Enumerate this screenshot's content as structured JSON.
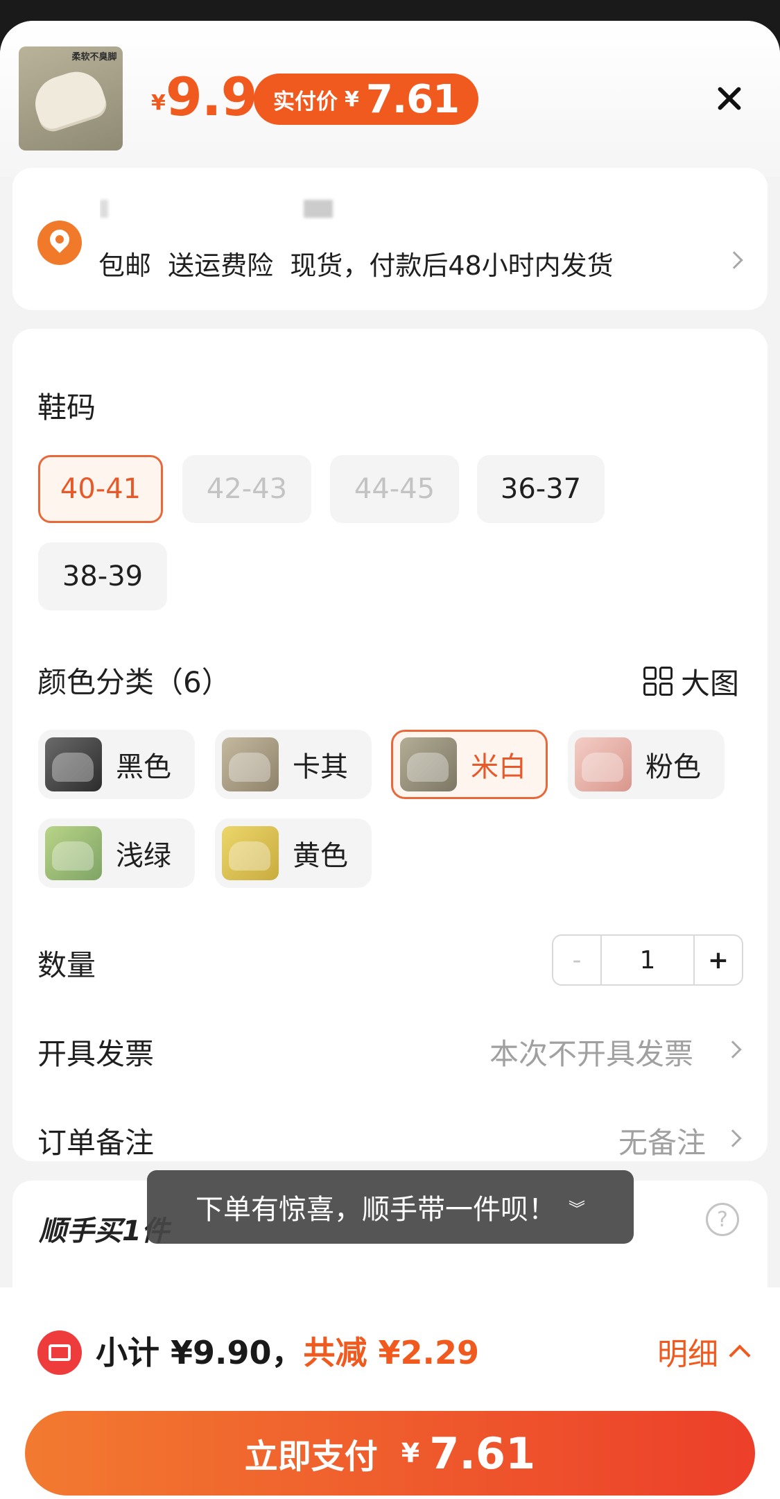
{
  "header": {
    "thumb_tag": "柔软不臭脚",
    "currency_symbol": "¥",
    "price": "9.9",
    "pay_label": "实付价",
    "pay_symbol": "¥",
    "pay_value": "7.61"
  },
  "address": {
    "line2": "包邮  送运费险  现货，付款后48小时内发货"
  },
  "spec": {
    "size_title": "鞋码",
    "sizes": [
      {
        "label": "40-41",
        "state": "selected"
      },
      {
        "label": "42-43",
        "state": "disabled"
      },
      {
        "label": "44-45",
        "state": "disabled"
      },
      {
        "label": "36-37",
        "state": "normal"
      },
      {
        "label": "38-39",
        "state": "normal"
      }
    ],
    "color_title": "颜色分类（6）",
    "big_view_label": "大图",
    "colors": [
      {
        "label": "黑色",
        "swatch": "#3a3a3a",
        "bg": "#5c5c5c",
        "state": "normal"
      },
      {
        "label": "卡其",
        "swatch": "#a89a7e",
        "bg": "#bdb199",
        "state": "normal"
      },
      {
        "label": "米白",
        "swatch": "#d9d3bd",
        "bg": "#a29d87",
        "state": "selected"
      },
      {
        "label": "粉色",
        "swatch": "#e9a9a0",
        "bg": "#f1c6bd",
        "state": "normal"
      },
      {
        "label": "浅绿",
        "swatch": "#b3d07a",
        "bg": "#9bb98a",
        "state": "normal"
      },
      {
        "label": "黄色",
        "swatch": "#e6cf5a",
        "bg": "#dcc36a",
        "state": "normal"
      }
    ],
    "quantity_title": "数量",
    "quantity_minus": "-",
    "quantity_value": "1",
    "quantity_plus": "+",
    "invoice_title": "开具发票",
    "invoice_value": "本次不开具发票",
    "note_title": "订单备注",
    "note_value": "无备注"
  },
  "addon": {
    "title": "顺手买1件",
    "help": "?"
  },
  "toast": {
    "text": "下单有惊喜，顺手带一件呗！",
    "icon": "»"
  },
  "bottom": {
    "subtotal_label": "小计 ¥9.90，",
    "discount_label": "共减 ¥2.29",
    "detail_label": "明细",
    "pay_label": "立即支付",
    "pay_symbol": "¥",
    "pay_value": "7.61"
  },
  "colors": {
    "accent": "#f05a1e",
    "selected_border": "#e8683a"
  }
}
